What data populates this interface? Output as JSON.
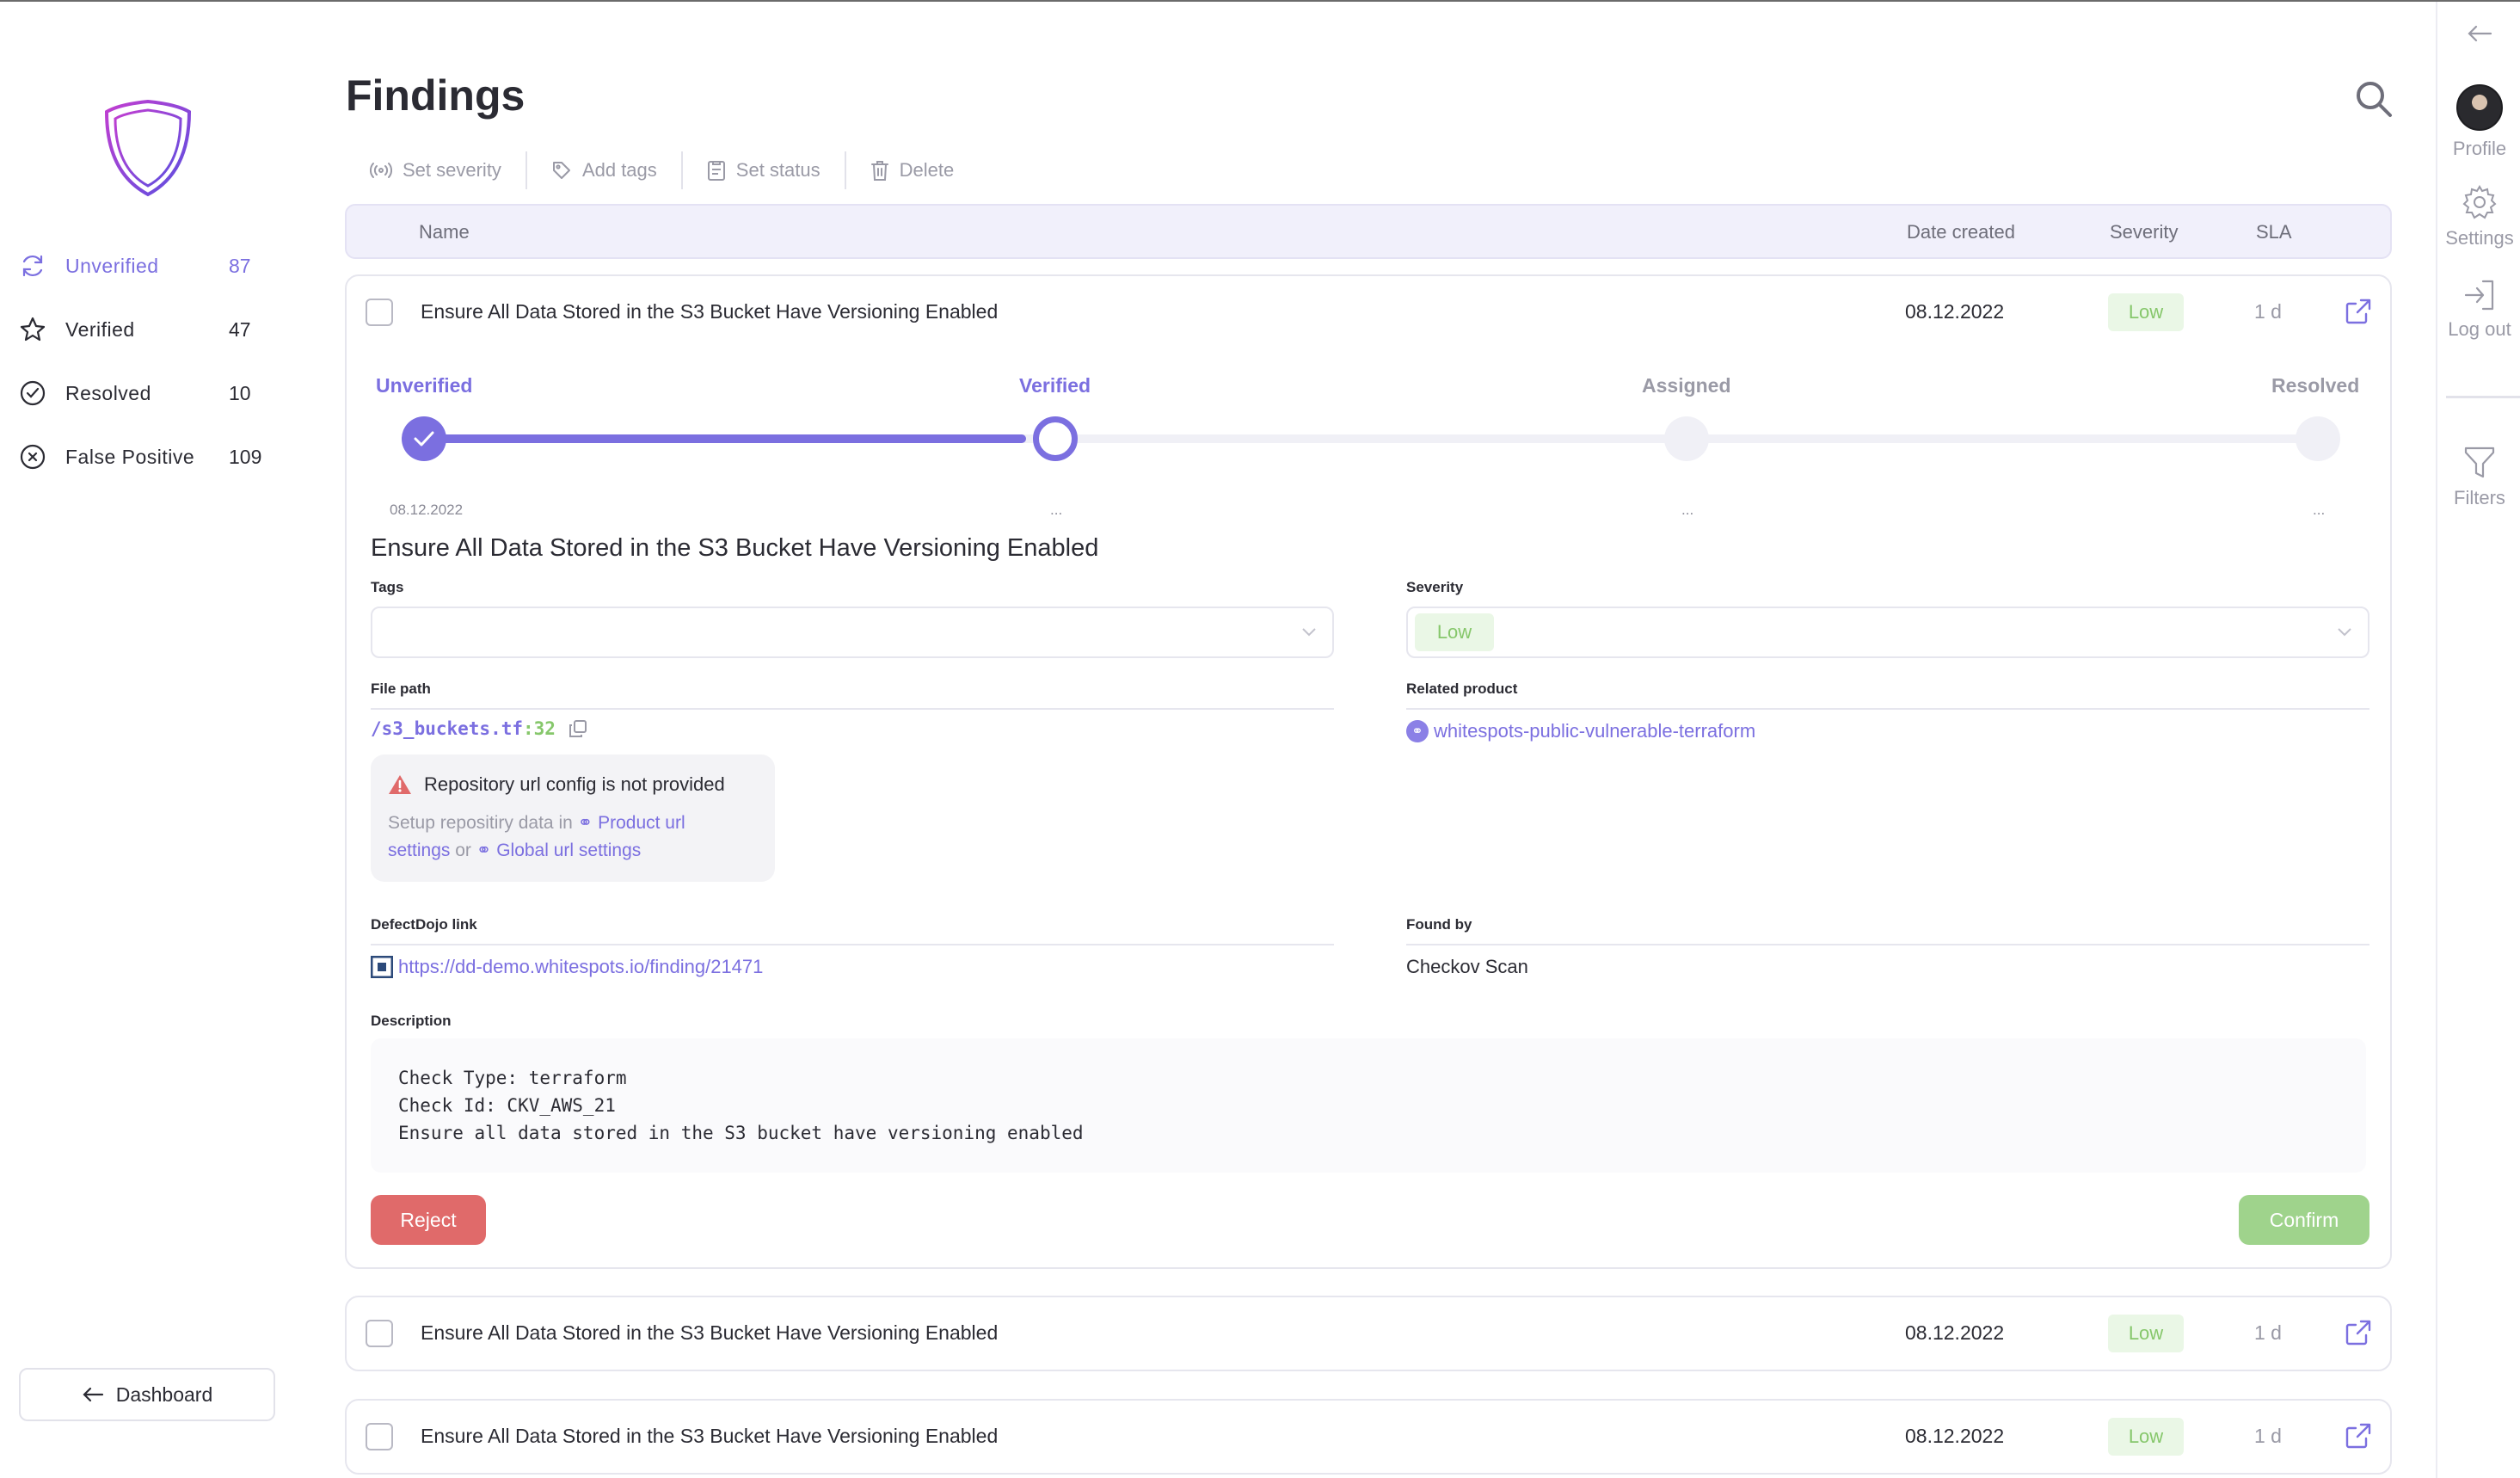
{
  "app": {
    "logo_icon": "shield-logo-icon",
    "accent": "#7b6fe0"
  },
  "sidebar": {
    "items": [
      {
        "label": "Unverified",
        "count": "87",
        "icon": "refresh-icon",
        "active": true
      },
      {
        "label": "Verified",
        "count": "47",
        "icon": "star-icon",
        "active": false
      },
      {
        "label": "Resolved",
        "count": "10",
        "icon": "check-circle-icon",
        "active": false
      },
      {
        "label": "False Positive",
        "count": "109",
        "icon": "x-circle-icon",
        "active": false
      }
    ],
    "dashboard_label": "Dashboard"
  },
  "rail": {
    "profile": "Profile",
    "settings": "Settings",
    "logout": "Log out",
    "filters": "Filters"
  },
  "page": {
    "title": "Findings"
  },
  "toolbar": {
    "set_severity": "Set severity",
    "add_tags": "Add tags",
    "set_status": "Set status",
    "delete": "Delete"
  },
  "table": {
    "columns": {
      "name": "Name",
      "date": "Date created",
      "severity": "Severity",
      "sla": "SLA"
    },
    "rows": [
      {
        "name": "Ensure All Data Stored in the S3 Bucket Have Versioning Enabled",
        "date": "08.12.2022",
        "severity": "Low",
        "sla": "1 d"
      },
      {
        "name": "Ensure All Data Stored in the S3 Bucket Have Versioning Enabled",
        "date": "08.12.2022",
        "severity": "Low",
        "sla": "1 d"
      },
      {
        "name": "Ensure All Data Stored in the S3 Bucket Have Versioning Enabled",
        "date": "08.12.2022",
        "severity": "Low",
        "sla": "1 d"
      }
    ]
  },
  "detail": {
    "steps": [
      {
        "label": "Unverified",
        "date": "08.12.2022"
      },
      {
        "label": "Verified",
        "date": "..."
      },
      {
        "label": "Assigned",
        "date": "..."
      },
      {
        "label": "Resolved",
        "date": "..."
      }
    ],
    "title": "Ensure All Data Stored in the S3 Bucket Have Versioning Enabled",
    "tags_label": "Tags",
    "severity_label": "Severity",
    "severity_value": "Low",
    "file_path_label": "File path",
    "file_path": "/s3_buckets.tf",
    "file_line": ":32",
    "related_product_label": "Related product",
    "related_product": "whitespots-public-vulnerable-terraform",
    "warning_title": "Repository url config is not provided",
    "warning_text_1": "Setup repositiry data in",
    "warning_link_1a": "Product url",
    "warning_link_1b": "settings",
    "warning_or": "or",
    "warning_link_2": "Global url settings",
    "dd_link_label": "DefectDojo link",
    "dd_link": "https://dd-demo.whitespots.io/finding/21471",
    "found_by_label": "Found by",
    "found_by": "Checkov Scan",
    "description_label": "Description",
    "description_lines": [
      "Check Type: terraform",
      "Check Id: CKV_AWS_21",
      "Ensure all data stored in the S3 bucket have versioning enabled"
    ],
    "reject": "Reject",
    "confirm": "Confirm"
  }
}
